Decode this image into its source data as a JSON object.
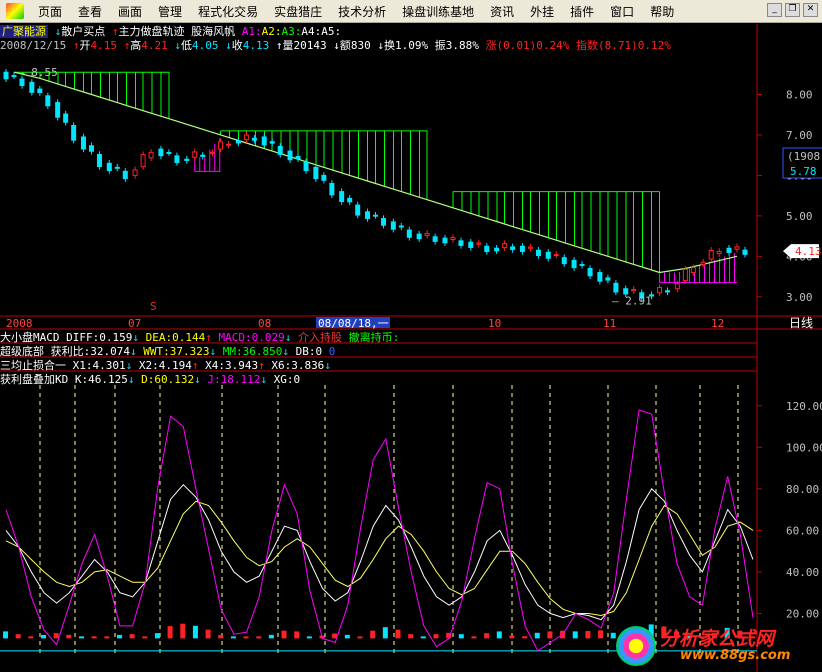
{
  "menu": [
    "页面",
    "查看",
    "画面",
    "管理",
    "程式化交易",
    "实盘猎庄",
    "技术分析",
    "操盘训练基地",
    "资讯",
    "外挂",
    "插件",
    "窗口",
    "帮助"
  ],
  "header": {
    "stock_name": "广聚能源",
    "indicators": [
      {
        "label": "散户买点",
        "color": "#ffffff"
      },
      {
        "label": "主力做盘轨迹",
        "color": "#ffffff"
      },
      {
        "label": "股海风帆",
        "color": "#ffffff"
      },
      {
        "label": "A1:",
        "color": "#ff00ff"
      },
      {
        "label": "A2:",
        "color": "#ffff00"
      },
      {
        "label": "A3:",
        "color": "#00ff00"
      },
      {
        "label": "A4:",
        "color": "#ffffff"
      },
      {
        "label": "A5:",
        "color": "#ffffff"
      }
    ]
  },
  "quote": {
    "date": "2008/12/15",
    "open_label": "开",
    "open": "4.15",
    "high_label": "高",
    "high": "4.21",
    "low_label": "低",
    "low": "4.05",
    "close_label": "收",
    "close": "4.13",
    "volume_label": "量",
    "volume": "20143",
    "amount_label": "额",
    "amount": "830",
    "turnover_label": "换",
    "turnover": "1.09%",
    "amplitude_label": "振",
    "amplitude": "3.88%",
    "change_label": "涨",
    "change": "(0.01)",
    "change_pct": "0.24%",
    "index_label": "指数",
    "index": "(8.71)",
    "index_pct": "0.12%"
  },
  "main_axis": {
    "price_ticks": [
      "8.00",
      "7.00",
      "6.00",
      "5.00",
      "4.00",
      "3.00"
    ],
    "code": "(1908)",
    "code_value": "5.78",
    "last_price_tag": "4.13",
    "high_marker": "8.55",
    "low_marker": "2.91",
    "s_marker": "S"
  },
  "date_axis": {
    "labels": [
      "2008",
      "07",
      "08",
      "08/08/18,一",
      "10",
      "11",
      "12"
    ],
    "period": "日线"
  },
  "sub1": {
    "name": "大小盘MACD",
    "items": [
      {
        "label": "DIFF:",
        "value": "0.159",
        "arrow": "↓",
        "color": "#ffffff"
      },
      {
        "label": "DEA:",
        "value": "0.144",
        "arrow": "↑",
        "color": "#ffff00"
      },
      {
        "label": "MACD:",
        "value": "0.029",
        "arrow": "↓",
        "color": "#ff00ff"
      },
      {
        "label": "介入持股",
        "value": "",
        "arrow": "",
        "color": "#ff3333"
      },
      {
        "label": "撤离持币:",
        "value": "",
        "arrow": "",
        "color": "#00ff00"
      }
    ]
  },
  "sub2": {
    "name": "超级底部",
    "items": [
      {
        "label": "获利比:",
        "value": "32.074",
        "arrow": "↓",
        "color": "#ffffff"
      },
      {
        "label": "WWT:",
        "value": "37.323",
        "arrow": "↓",
        "color": "#ffff00"
      },
      {
        "label": "MM:",
        "value": "36.850",
        "arrow": "↓",
        "color": "#00ff00"
      },
      {
        "label": "DB:",
        "value": "0",
        "arrow": "",
        "color": "#ffffff"
      },
      {
        "label": "0",
        "value": "",
        "arrow": "",
        "color": "#3366ff"
      }
    ]
  },
  "sub3": {
    "name": "三均止损合一",
    "items": [
      {
        "label": "X1:",
        "value": "4.301",
        "arrow": "↓",
        "color": "#ffffff"
      },
      {
        "label": "X2:",
        "value": "4.194",
        "arrow": "↑",
        "color": "#ffffff"
      },
      {
        "label": "X4:",
        "value": "3.943",
        "arrow": "↑",
        "color": "#ffffff"
      },
      {
        "label": "X6:",
        "value": "3.836",
        "arrow": "↓",
        "color": "#ffffff"
      }
    ]
  },
  "sub4": {
    "name": "获利盘叠加KD",
    "items": [
      {
        "label": "K:",
        "value": "46.125",
        "arrow": "↓",
        "color": "#ffffff"
      },
      {
        "label": "D:",
        "value": "60.132",
        "arrow": "↓",
        "color": "#ffff00"
      },
      {
        "label": "J:",
        "value": "18.112",
        "arrow": "↓",
        "color": "#ff00ff"
      },
      {
        "label": "XG:",
        "value": "0",
        "arrow": "",
        "color": "#ffffff"
      }
    ]
  },
  "kd_axis": {
    "ticks": [
      "120.00",
      "100.00",
      "80.00",
      "60.00",
      "40.00",
      "20.00"
    ]
  },
  "watermark": {
    "title": "分析家公式网",
    "url": "www.88gs.com"
  },
  "colors": {
    "up": "#ff2222",
    "down": "#00e5ff",
    "green": "#00ff00",
    "magenta": "#ff00ff",
    "yellow": "#ffff66",
    "axis": "#c00000"
  },
  "chart_data": [
    {
      "type": "candlestick",
      "title": "广聚能源",
      "period": "日线",
      "ylim": [
        2.6,
        9.0
      ],
      "x": [
        "2008-06-02",
        "2008-06-09",
        "2008-06-16",
        "2008-06-23",
        "2008-06-30",
        "2008-07-07",
        "2008-07-14",
        "2008-07-21",
        "2008-07-28",
        "2008-08-04",
        "2008-08-11",
        "2008-08-18",
        "2008-08-25",
        "2008-09-01",
        "2008-09-08",
        "2008-09-15",
        "2008-09-22",
        "2008-09-29",
        "2008-10-06",
        "2008-10-13",
        "2008-10-20",
        "2008-10-27",
        "2008-11-03",
        "2008-11-10",
        "2008-11-17",
        "2008-11-24",
        "2008-12-01",
        "2008-12-08",
        "2008-12-15"
      ],
      "close": [
        8.3,
        7.8,
        6.95,
        6.3,
        6.0,
        6.65,
        6.4,
        6.55,
        6.85,
        6.95,
        6.6,
        6.2,
        5.6,
        5.1,
        4.85,
        4.55,
        4.45,
        4.35,
        4.2,
        4.25,
        4.1,
        3.9,
        3.6,
        3.2,
        3.05,
        3.2,
        3.8,
        4.2,
        4.13
      ],
      "series": [
        {
          "name": "A1",
          "values": [
            8.55,
            8.4,
            8.2,
            8.0,
            7.8,
            7.6,
            7.4,
            7.2,
            7.0,
            6.8,
            6.6,
            6.4,
            6.2,
            6.0,
            5.8,
            5.6,
            5.4,
            5.2,
            5.0,
            4.8,
            4.6,
            4.4,
            4.2,
            4.0,
            3.8,
            3.6,
            3.7,
            3.85,
            4.0
          ]
        }
      ],
      "annotations": [
        {
          "label": "8.55"
        },
        {
          "label": "2.91"
        },
        {
          "label": "S"
        }
      ]
    },
    {
      "type": "line",
      "title": "获利盘叠加KD",
      "ylim": [
        0,
        130
      ],
      "x": [
        1,
        2,
        3,
        4,
        5,
        6,
        7,
        8,
        9,
        10,
        11,
        12,
        13,
        14,
        15,
        16,
        17,
        18,
        19,
        20,
        21,
        22,
        23,
        24,
        25,
        26,
        27,
        28,
        29,
        30,
        31,
        32,
        33,
        34,
        35,
        36,
        37,
        38,
        39,
        40,
        41,
        42,
        43,
        44,
        45,
        46,
        47,
        48,
        49,
        50,
        51,
        52,
        53,
        54,
        55,
        56,
        57,
        58,
        59,
        60
      ],
      "series": [
        {
          "name": "K",
          "values": [
            60,
            52,
            40,
            30,
            25,
            30,
            38,
            46,
            40,
            30,
            28,
            35,
            55,
            75,
            82,
            76,
            65,
            50,
            40,
            35,
            38,
            50,
            62,
            60,
            45,
            32,
            26,
            30,
            45,
            62,
            72,
            65,
            52,
            38,
            28,
            24,
            28,
            40,
            55,
            60,
            48,
            34,
            24,
            20,
            18,
            20,
            19,
            17,
            24,
            45,
            70,
            80,
            74,
            60,
            48,
            40,
            55,
            70,
            62,
            46
          ]
        },
        {
          "name": "D",
          "values": [
            55,
            52,
            46,
            40,
            35,
            33,
            35,
            40,
            41,
            38,
            35,
            35,
            42,
            55,
            68,
            74,
            72,
            64,
            55,
            47,
            43,
            45,
            52,
            56,
            52,
            44,
            36,
            33,
            37,
            46,
            56,
            62,
            58,
            50,
            40,
            32,
            29,
            32,
            41,
            50,
            50,
            44,
            35,
            27,
            22,
            20,
            20,
            19,
            21,
            30,
            46,
            62,
            72,
            68,
            58,
            48,
            52,
            62,
            64,
            60
          ]
        },
        {
          "name": "J",
          "values": [
            70,
            52,
            28,
            12,
            5,
            24,
            44,
            58,
            38,
            14,
            14,
            35,
            81,
            115,
            110,
            80,
            51,
            22,
            10,
            11,
            28,
            60,
            82,
            68,
            31,
            8,
            6,
            24,
            61,
            94,
            104,
            71,
            40,
            14,
            4,
            8,
            26,
            56,
            83,
            80,
            44,
            14,
            2,
            6,
            10,
            20,
            17,
            13,
            30,
            75,
            118,
            116,
            78,
            44,
            28,
            24,
            61,
            86,
            58,
            18
          ]
        }
      ]
    }
  ]
}
